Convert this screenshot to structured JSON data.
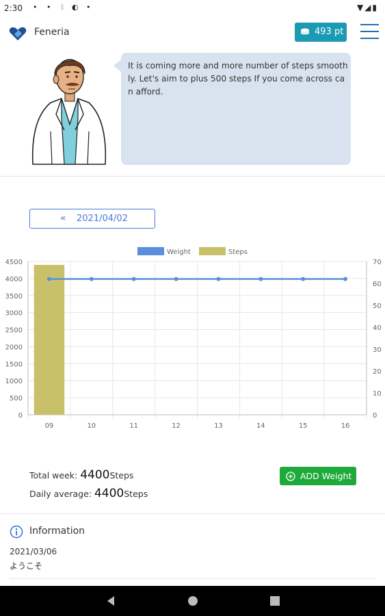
{
  "status_bar": {
    "time": "2:30"
  },
  "header": {
    "app_name": "Feneria",
    "points": "493 pt"
  },
  "coach": {
    "message": "It is coming more and more number of steps smoothly. Let's aim to plus 500 steps If you come across can afford."
  },
  "date_nav": {
    "date": "2021/04/02",
    "prev_icon": "double-chevron-left-icon"
  },
  "chart_data": {
    "type": "bar",
    "categories": [
      "09",
      "10",
      "11",
      "12",
      "13",
      "14",
      "15",
      "16"
    ],
    "series": [
      {
        "name": "Weight",
        "type": "line",
        "axis": "right",
        "color": "#5b8fd9",
        "values": [
          62,
          62,
          62,
          62,
          62,
          62,
          62,
          62
        ]
      },
      {
        "name": "Steps",
        "type": "bar",
        "axis": "left",
        "color": "#c9c06a",
        "values": [
          4400,
          0,
          0,
          0,
          0,
          0,
          0,
          0
        ]
      }
    ],
    "y_left": {
      "min": 0,
      "max": 4500,
      "ticks": [
        0,
        500,
        1000,
        1500,
        2000,
        2500,
        3000,
        3500,
        4000,
        4500
      ]
    },
    "y_right": {
      "min": 0,
      "max": 70,
      "ticks": [
        0,
        10,
        20,
        30,
        40,
        50,
        60,
        70
      ]
    },
    "legend_position": "top",
    "grid": true
  },
  "summary": {
    "total_label": "Total week: ",
    "total_value": "4400",
    "total_unit": "Steps",
    "avg_label": "Daily average: ",
    "avg_value": "4400",
    "avg_unit": "Steps",
    "add_weight_label": "ADD Weight"
  },
  "information": {
    "title": "Information",
    "items": [
      {
        "date": "2021/03/06",
        "text": "ようこそ"
      }
    ]
  },
  "colors": {
    "accent": "#1a9bb3",
    "primary": "#4a7ad6",
    "success": "#1eaa3a",
    "bubble": "#d9e3ef"
  }
}
